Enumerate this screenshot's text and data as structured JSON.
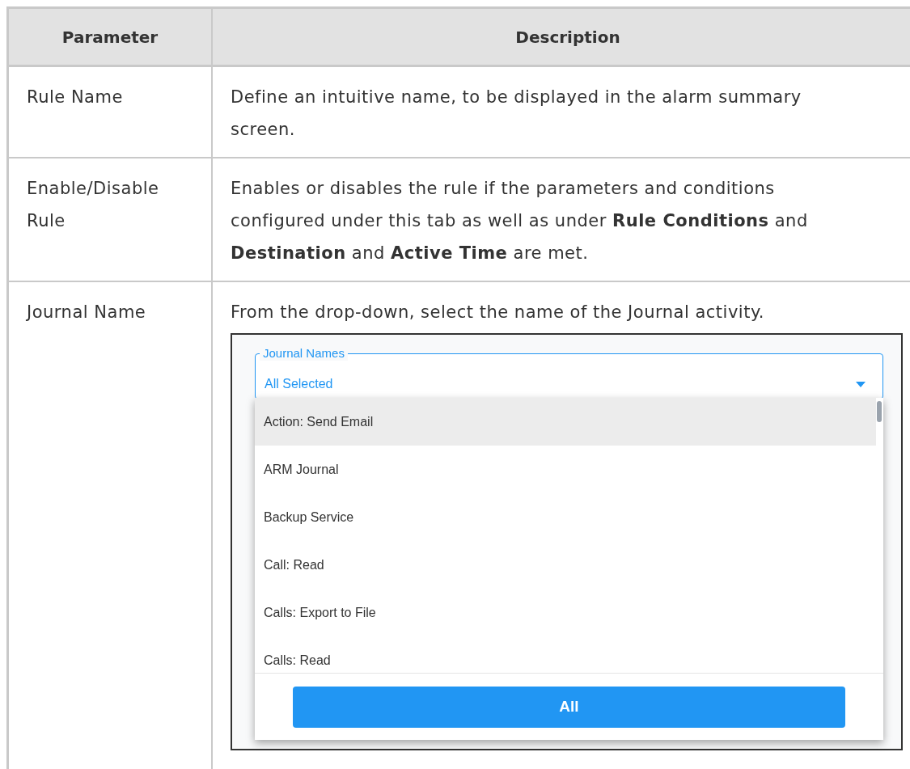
{
  "table": {
    "columns": [
      "Parameter",
      "Description"
    ],
    "rows": [
      {
        "parameter": "Rule Name",
        "description": "Define an intuitive name, to be displayed in the alarm summary screen."
      },
      {
        "parameter": "Enable/Disable Rule",
        "description": "Enables or disables the rule if the parameters and conditions configured under this tab as well as under **Rule Conditions** and **Destination** and **Active Time** are met."
      },
      {
        "parameter": "Journal Name",
        "description": "From the drop-down, select the name of the Journal activity.",
        "screenshot": {
          "field": {
            "label": "Journal Names",
            "value": "All Selected"
          },
          "options": [
            {
              "label": "Action: Send Email",
              "highlighted": true
            },
            {
              "label": "ARM Journal",
              "highlighted": false
            },
            {
              "label": "Backup Service",
              "highlighted": false
            },
            {
              "label": "Call: Read",
              "highlighted": false
            },
            {
              "label": "Calls: Export to File",
              "highlighted": false
            },
            {
              "label": "Calls: Read",
              "highlighted": false
            }
          ],
          "button": "All"
        }
      }
    ]
  }
}
